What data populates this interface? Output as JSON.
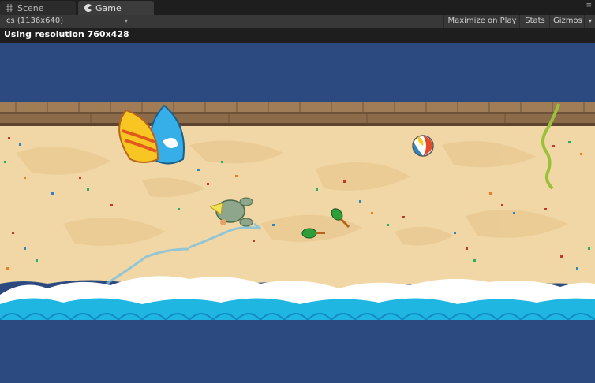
{
  "tabs": {
    "scene_label": "Scene",
    "game_label": "Game",
    "menu_glyph": "≡"
  },
  "toolbar": {
    "aspect_value": "cs (1136x640)",
    "maximize_label": "Maximize on Play",
    "stats_label": "Stats",
    "gizmos_label": "Gizmos"
  },
  "status": {
    "resolution_text": "Using resolution 760x428"
  },
  "colors": {
    "editor_dark": "#1e1e1e",
    "toolbar": "#383838",
    "game_bg": "#2c4a80",
    "sand": "#f2d7a6",
    "sea": "#1fb6e2",
    "foam": "#ffffff"
  },
  "icons": {
    "scene_tab_icon": "grid-icon",
    "game_tab_icon": "pacman-icon"
  }
}
